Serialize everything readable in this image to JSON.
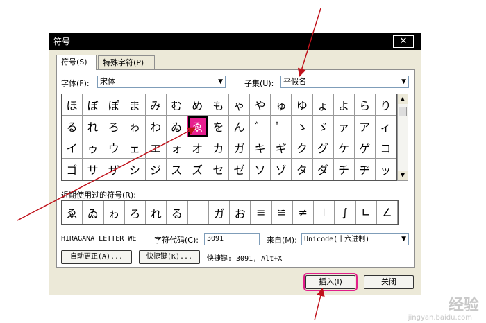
{
  "window": {
    "title": "符号",
    "close_glyph": "✕"
  },
  "tabs": [
    {
      "label": "符号(S)"
    },
    {
      "label": "特殊字符(P)"
    }
  ],
  "font": {
    "label": "字体(F):",
    "value": "宋体"
  },
  "subset": {
    "label": "子集(U):",
    "value": "平假名"
  },
  "symbols": [
    "ほ",
    "ぼ",
    "ぽ",
    "ま",
    "み",
    "む",
    "め",
    "も",
    "ゃ",
    "や",
    "ゅ",
    "ゆ",
    "ょ",
    "よ",
    "ら",
    "り",
    "る",
    "れ",
    "ろ",
    "ゎ",
    "わ",
    "ゐ",
    "ゑ",
    "を",
    "ん",
    "゛",
    "゜",
    "ゝ",
    "ゞ",
    "ァ",
    "ア",
    "ィ",
    "イ",
    "ゥ",
    "ウ",
    "ェ",
    "エ",
    "ォ",
    "オ",
    "カ",
    "ガ",
    "キ",
    "ギ",
    "ク",
    "グ",
    "ケ",
    "ゲ",
    "コ",
    "ゴ",
    "サ",
    "ザ",
    "シ",
    "ジ",
    "ス",
    "ズ",
    "セ",
    "ゼ",
    "ソ",
    "ゾ",
    "タ",
    "ダ",
    "チ",
    "ヂ",
    "ッ"
  ],
  "selected_index": 22,
  "recent": {
    "label": "近期使用过的符号(R):",
    "items": [
      "ゑ",
      "ゐ",
      "ゎ",
      "ろ",
      "れ",
      "る",
      "",
      "ガ",
      "お",
      "≡",
      "≌",
      "≠",
      "⊥",
      "∫",
      "∟",
      "∠"
    ]
  },
  "char_name": "HIRAGANA LETTER WE",
  "char_code": {
    "label": "字符代码(C):",
    "value": "3091"
  },
  "from": {
    "label": "来自(M):",
    "value": "Unicode(十六进制)"
  },
  "buttons": {
    "autocorrect": "自动更正(A)...",
    "shortcut_key": "快捷键(K)...",
    "shortcut_text": "快捷键: 3091, Alt+X",
    "insert": "插入(I)",
    "close": "关闭"
  },
  "watermark": {
    "text": "经验",
    "url": "jingyan.baidu.com"
  }
}
